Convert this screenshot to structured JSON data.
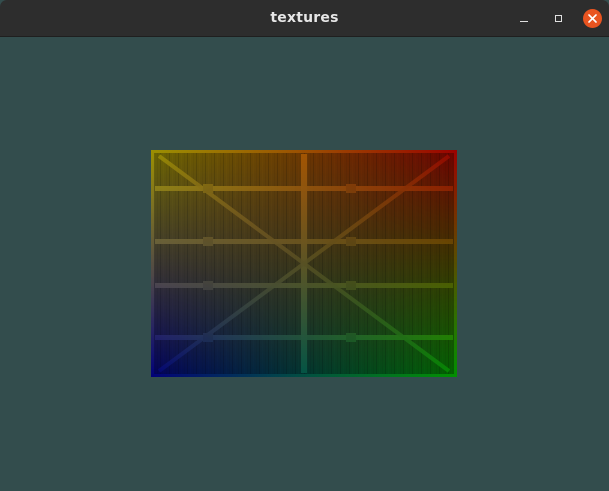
{
  "window": {
    "title": "textures",
    "background_color": "#334d4d"
  },
  "titlebar": {
    "minimize_icon": "minimize-icon",
    "maximize_icon": "maximize-icon",
    "close_icon": "close-icon",
    "close_color": "#e95420"
  },
  "texture": {
    "description_icon": "wooden-crate-texture",
    "vertex_colors": {
      "top_left": "#ffff00",
      "top_right": "#ff0000",
      "bottom_left": "#0000ff",
      "bottom_right": "#00ff00"
    }
  }
}
